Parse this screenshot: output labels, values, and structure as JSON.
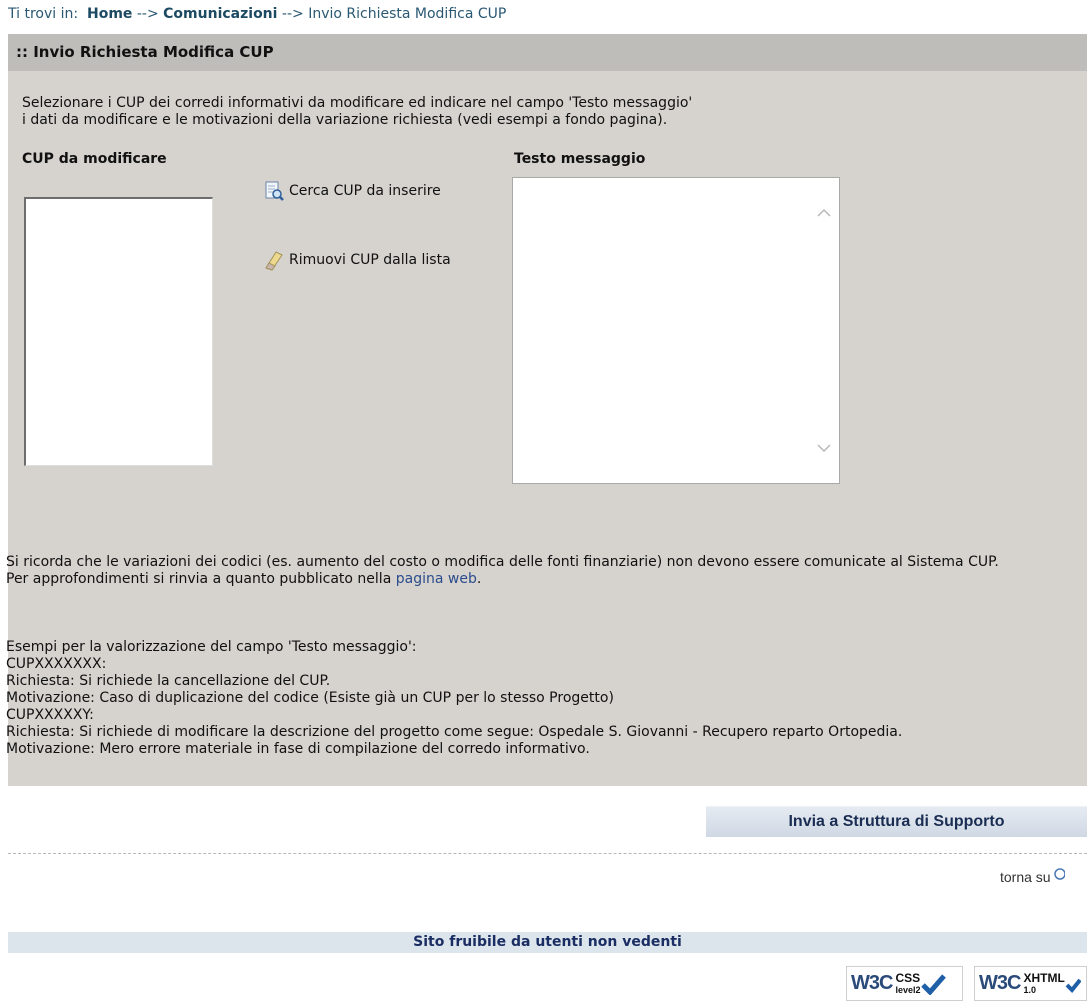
{
  "breadcrumb": {
    "prefix": "Ti trovi in:",
    "home": "Home",
    "arrow1": "-->",
    "comunicazioni": "Comunicazioni",
    "arrow2": "-->",
    "current": "Invio Richiesta Modifica CUP"
  },
  "panel": {
    "title": ":: Invio Richiesta Modifica CUP",
    "intro_line1": "Selezionare i CUP dei corredi informativi da modificare ed indicare nel campo 'Testo messaggio'",
    "intro_line2": "i dati da modificare e le motivazioni della variazione richiesta (vedi esempi a fondo pagina).",
    "cup_label": "CUP da modificare",
    "message_label": "Testo messaggio",
    "search_action": "Cerca CUP da inserire",
    "remove_action": "Rimuovi CUP dalla lista",
    "message_value": ""
  },
  "notes": {
    "line1": "Si ricorda che le variazioni dei codici (es. aumento del costo o modifica delle fonti finanziarie) non devono essere comunicate al Sistema CUP.",
    "line2_prefix": "Per approfondimenti si rinvia a quanto pubblicato nella",
    "line2_link": "pagina web",
    "line2_suffix": "."
  },
  "examples": [
    "Esempi per la valorizzazione del campo 'Testo messaggio':",
    "CUPXXXXXXX:",
    "Richiesta: Si richiede la cancellazione del CUP.",
    "Motivazione: Caso di duplicazione del codice (Esiste già un CUP per lo stesso Progetto)",
    "CUPXXXXXY:",
    "Richiesta: Si richiede di modificare la descrizione del progetto come segue: Ospedale S. Giovanni - Recupero reparto Ortopedia.",
    "Motivazione: Mero errore materiale in fase di compilazione del corredo informativo."
  ],
  "submit_label": "Invia a Struttura di Supporto",
  "back_to_top": "torna su",
  "footer": {
    "accessibility": "Sito fruibile da utenti non vedenti",
    "css_badge": {
      "logo": "W3C",
      "spec": "CSS",
      "level": "level2"
    },
    "xhtml_badge": {
      "logo": "W3C",
      "spec": "XHTML",
      "level": "1.0"
    }
  },
  "colors": {
    "panel_bg": "#d6d3ce",
    "header_bg": "#bfbdba",
    "link": "#2a4c8c",
    "footer_bar": "#dce4ec"
  }
}
